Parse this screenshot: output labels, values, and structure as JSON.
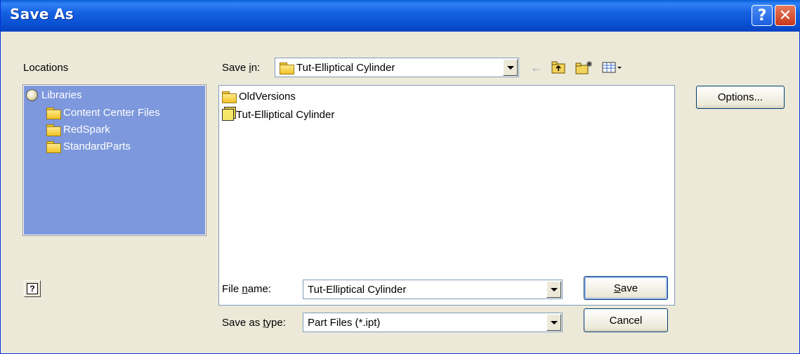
{
  "window": {
    "title": "Save As",
    "help_glyph": "?",
    "close_glyph": "✕"
  },
  "locations": {
    "label": "Locations",
    "items": [
      {
        "label": "Libraries",
        "icon": "library-icon"
      },
      {
        "label": "Content Center Files",
        "icon": "folder-icon"
      },
      {
        "label": "RedSpark",
        "icon": "folder-icon"
      },
      {
        "label": "StandardParts",
        "icon": "folder-icon"
      }
    ]
  },
  "save_in": {
    "label_prefix": "Save ",
    "label_ul": "i",
    "label_suffix": "n:",
    "value": "Tut-Elliptical Cylinder"
  },
  "toolbar": {
    "back_icon": "back-arrow-icon",
    "up_icon": "up-folder-icon",
    "new_folder_icon": "new-folder-icon",
    "view_menu_icon": "view-menu-icon"
  },
  "files": [
    {
      "name": "OldVersions",
      "icon": "folder-icon"
    },
    {
      "name": "Tut-Elliptical Cylinder",
      "icon": "part-file-icon"
    }
  ],
  "options_button": "Options...",
  "file_name": {
    "label_prefix": "File ",
    "label_ul": "n",
    "label_suffix": "ame:",
    "value": "Tut-Elliptical Cylinder"
  },
  "save_as_type": {
    "label_prefix": "Save as ",
    "label_ul": "t",
    "label_suffix": "ype:",
    "value": "Part Files (*.ipt)"
  },
  "buttons": {
    "save_ul": "S",
    "save_rest": "ave",
    "cancel": "Cancel",
    "help_glyph": "?"
  },
  "colors": {
    "titlebar": "#0a52d3",
    "locations_bg": "#7d98dc",
    "dialog_bg": "#ece9d8"
  }
}
